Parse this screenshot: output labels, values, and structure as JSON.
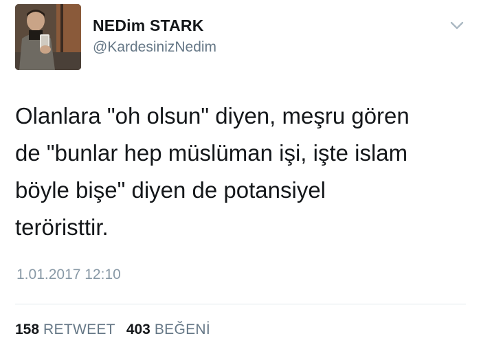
{
  "user": {
    "display_name": "NEDim STARK",
    "handle": "@KardesinizNedim",
    "avatar_icon": "profile-photo"
  },
  "tweet": {
    "text": "Olanlara \"oh olsun\" diyen, meşru gören\nde \"bunlar hep müslüman işi, işte islam\nböyle bişe\" diyen de potansiyel\nteröristtir.",
    "timestamp": "1.01.2017 12:10"
  },
  "stats": {
    "retweets_count": "158",
    "retweets_label": "RETWEET",
    "likes_count": "403",
    "likes_label": "BEĞENİ"
  },
  "menu": {
    "icon": "chevron-down-icon"
  },
  "colors": {
    "primary_text": "#14171a",
    "secondary_text": "#657786",
    "timestamp": "#8899a6",
    "divider": "#e1e8ed"
  }
}
